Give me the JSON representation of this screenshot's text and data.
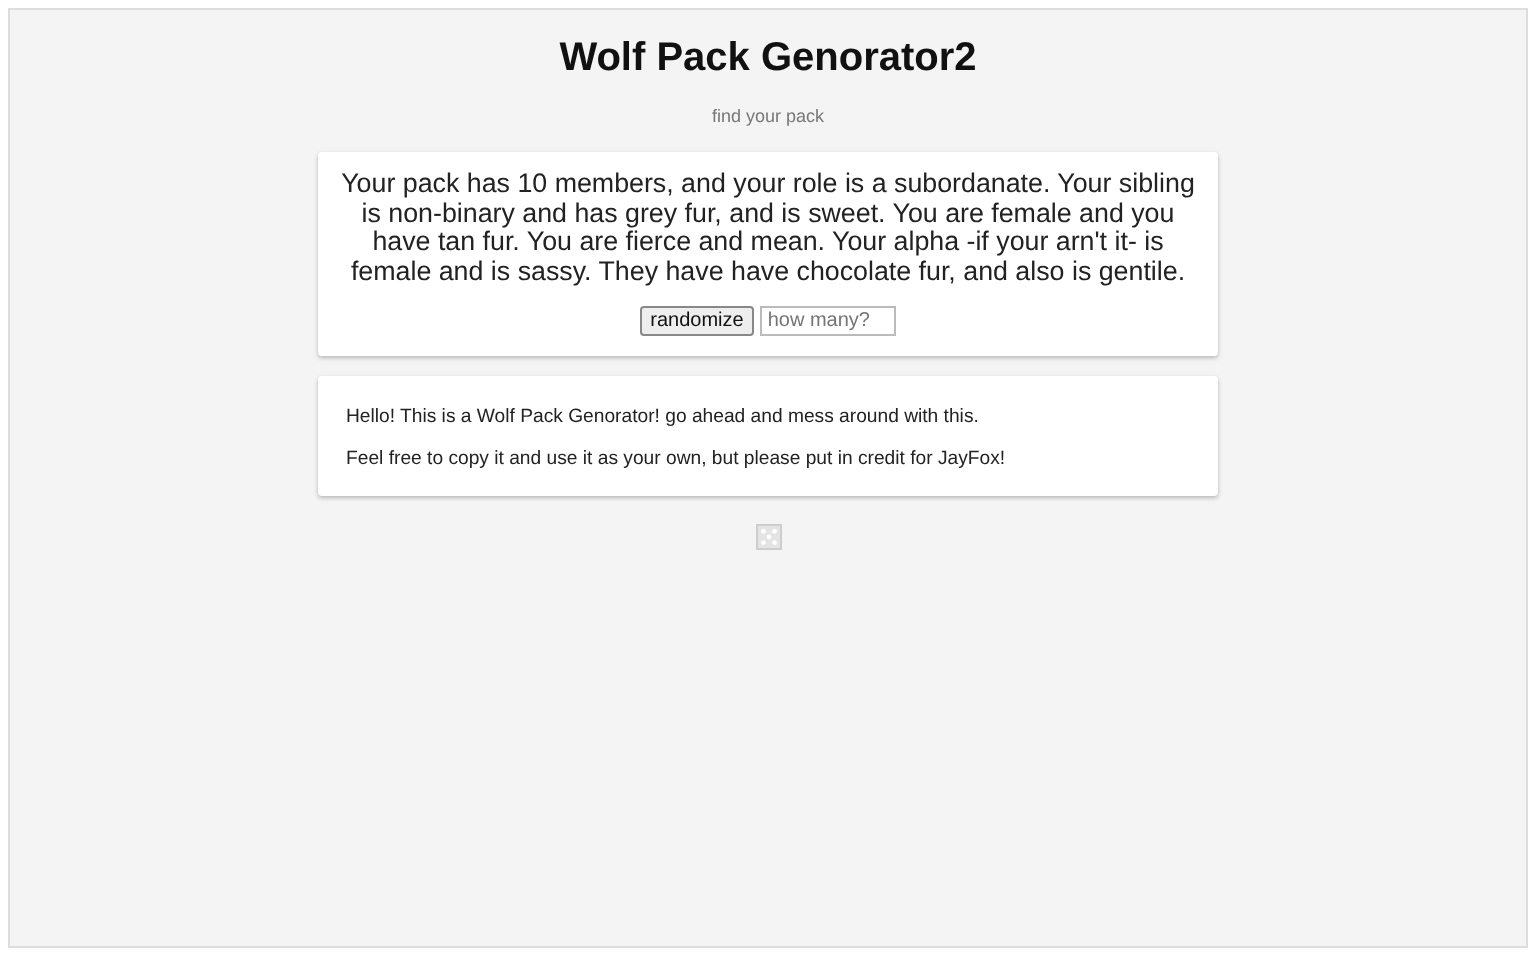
{
  "title": "Wolf Pack Genorator2",
  "subtitle": "find your pack",
  "result": "Your pack has 10 members, and your role is a subordanate. Your sibling is non-binary and has grey fur, and is sweet. You are female and you have tan fur. You are fierce and mean. Your alpha -if your arn't it- is female and is sassy. They have have chocolate fur, and also is gentile.",
  "randomize_button": "randomize",
  "count_field": {
    "placeholder": "how many?"
  },
  "info": [
    "Hello! This is a Wolf Pack Genorator! go ahead and mess around with this.",
    "Feel free to copy it and use it as your own, but please put in credit for JayFox!"
  ]
}
